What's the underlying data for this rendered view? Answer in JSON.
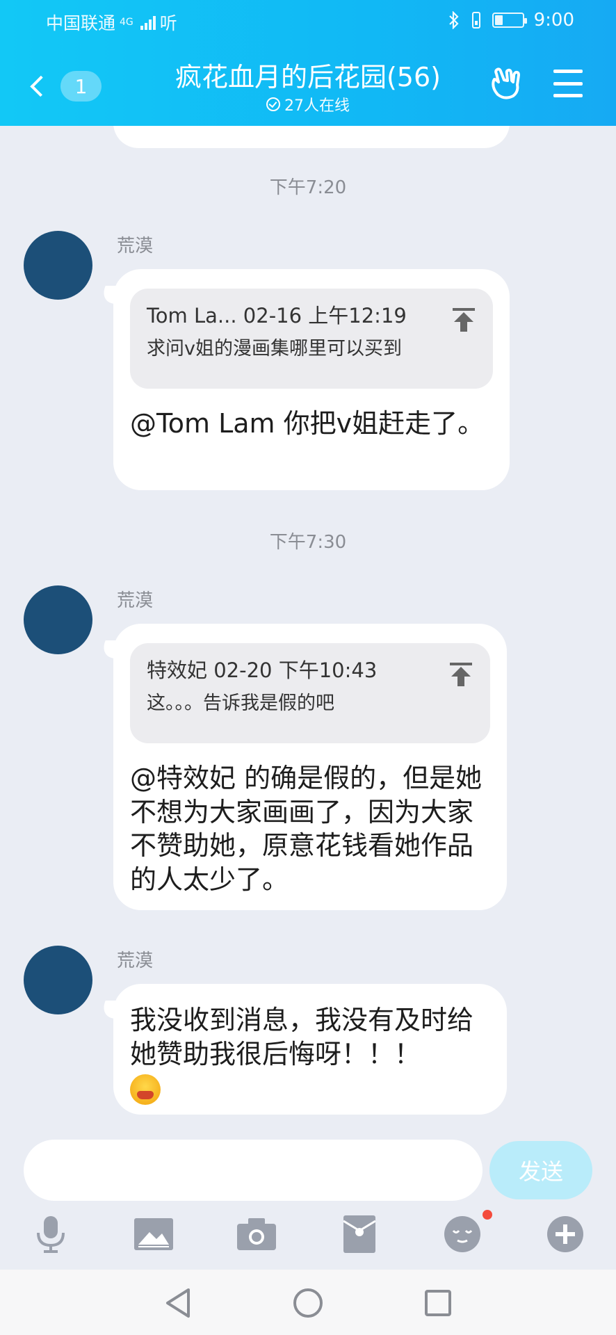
{
  "status_bar": {
    "carrier": "中国联通",
    "network": "4G",
    "extra": "听",
    "time": "9:00",
    "battery_level": 0.3
  },
  "header": {
    "unread_count": "1",
    "title": "疯花血月的后花园(56)",
    "online_text": "27人在线",
    "icons": [
      "back-chevron-icon",
      "rock-hand-icon",
      "menu-icon"
    ]
  },
  "messages": [
    {
      "time": "下午7:20",
      "sender": "荒漠",
      "quote": {
        "head": "Tom La... 02-16 上午12:19",
        "text": "求问v姐的漫画集哪里可以买到"
      },
      "text": "@Tom Lam 你把v姐赶走了。"
    },
    {
      "time": "下午7:30",
      "sender": "荒漠",
      "quote": {
        "head": "特效妃 02-20 下午10:43",
        "text": "这。。。告诉我是假的吧"
      },
      "text": "@特效妃 的确是假的，但是她不想为大家画画了，因为大家不赞助她，原意花钱看她作品的人太少了。"
    },
    {
      "time": "",
      "sender": "荒漠",
      "text": "我没收到消息，我没有及时给她赞助我很后悔呀！！！",
      "emoji": "crying-emoji"
    }
  ],
  "input": {
    "placeholder": "",
    "send_label": "发送"
  },
  "toolbar": {
    "icons": [
      "microphone-icon",
      "image-icon",
      "camera-icon",
      "red-packet-icon",
      "emoji-icon",
      "plus-icon"
    ]
  },
  "nav": {
    "icons": [
      "back-triangle-icon",
      "home-circle-icon",
      "recents-square-icon"
    ]
  },
  "colors": {
    "header_gradient_start": "#12c8f6",
    "header_gradient_end": "#16aaf3",
    "chat_background": "#eaedf4",
    "avatar": "#1c4f78",
    "send_button": "#b9ecfa",
    "notification_dot": "#f44b3c"
  }
}
